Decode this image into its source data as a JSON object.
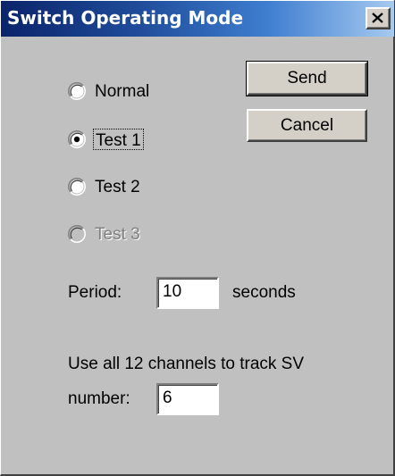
{
  "window": {
    "title": "Switch Operating Mode",
    "close_icon": "close-icon"
  },
  "buttons": {
    "send_label": "Send",
    "cancel_label": "Cancel"
  },
  "mode_options": [
    {
      "label": "Normal",
      "selected": false,
      "enabled": true
    },
    {
      "label": "Test 1",
      "selected": true,
      "enabled": true
    },
    {
      "label": "Test 2",
      "selected": false,
      "enabled": true
    },
    {
      "label": "Test 3",
      "selected": false,
      "enabled": false
    }
  ],
  "period": {
    "label": "Period:",
    "value": "10",
    "unit": "seconds"
  },
  "sv": {
    "description": "Use all 12 channels to track SV",
    "label": "number:",
    "value": "6"
  },
  "colors": {
    "title_gradient_start": "#0a246a",
    "title_gradient_end": "#a6caf0",
    "face": "#c0c0c0",
    "disabled_text": "#808080"
  }
}
